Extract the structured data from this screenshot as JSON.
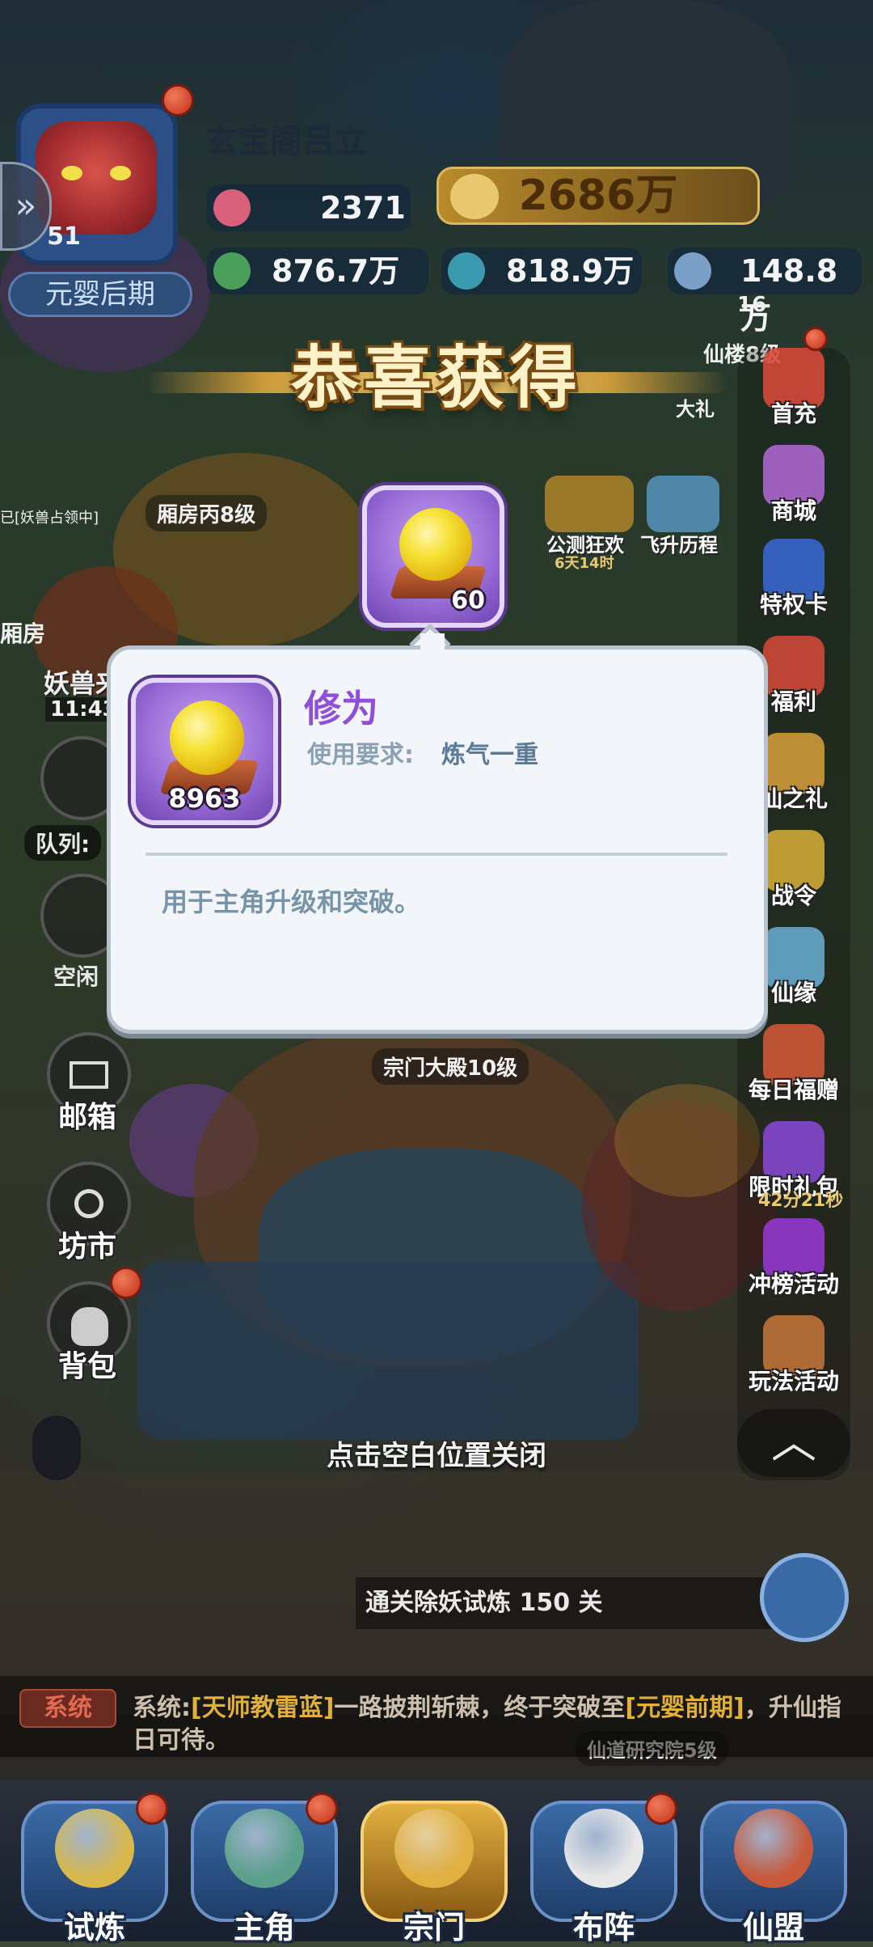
{
  "header": {
    "player_name": "玄宝阁吕立",
    "level": "51",
    "realm": "元婴后期",
    "resources": {
      "vitality": "2371",
      "spirit": "876.7万",
      "crystal": "818.9万",
      "cloud": "148.8万"
    },
    "combat_power": "2686万"
  },
  "reward_banner": {
    "title": "恭喜获得"
  },
  "reward_item": {
    "quantity": "60"
  },
  "item_popup": {
    "owned_count": "8963",
    "name": "修为",
    "requirement_label": "使用要求:",
    "requirement_value": "炼气一重",
    "description": "用于主角升级和突破。"
  },
  "close_hint": "点击空白位置关闭",
  "map_labels": {
    "wing_room_c": "厢房丙8级",
    "sect_hall": "宗门大殿10级",
    "research_institute": "仙道研究院5级",
    "beast_occupied": "已[妖兽占领中]",
    "wing_room_partial": "厢房",
    "beast_partial": "妖兽来",
    "timer_partial": "11:43:",
    "tower_partial": "仙楼8级",
    "tower_badge": "16",
    "gift_partial": "大礼"
  },
  "events": {
    "test_event": "公测狂欢",
    "test_event_timer": "6天14时",
    "ascension": "飞升历程"
  },
  "left_menu": {
    "team": "队列:",
    "idle": "空闲",
    "mail": "邮箱",
    "market": "坊市",
    "backpack": "背包"
  },
  "right_menu": [
    {
      "label": "首充",
      "color": "#e04a3a"
    },
    {
      "label": "商城",
      "color": "#b46ad8"
    },
    {
      "label": "特权卡",
      "color": "#3a6ad8"
    },
    {
      "label": "福利",
      "color": "#d84a3a"
    },
    {
      "label": "仙之礼",
      "color": "#d8a03a"
    },
    {
      "label": "战令",
      "color": "#d8b03a"
    },
    {
      "label": "仙缘",
      "color": "#6ab0d8"
    },
    {
      "label": "每日福赠",
      "color": "#d85a3a"
    },
    {
      "label": "限时礼包",
      "color": "#8a4ad8"
    },
    {
      "label": "冲榜活动",
      "color": "#9a3ad8"
    },
    {
      "label": "玩法活动",
      "color": "#c8783a"
    }
  ],
  "limited_pack_timer": "42分21秒",
  "quest": "通关除妖试炼 150 关",
  "chat": {
    "channel": "系统",
    "prefix": "系统:",
    "player": "[天师教雷蓝]",
    "middle": "一路披荆斩棘，终于突破至",
    "realm": "[元婴前期]",
    "suffix": "，升仙指日可待。"
  },
  "bottom_nav": [
    {
      "label": "试炼"
    },
    {
      "label": "主角"
    },
    {
      "label": "宗门"
    },
    {
      "label": "布阵"
    },
    {
      "label": "仙盟"
    }
  ],
  "colors": {
    "popup_bg": "#f2f6fa",
    "item_purple": "#9b6fd8",
    "title_purple": "#8f4fd8",
    "gold": "#e0b03a"
  }
}
